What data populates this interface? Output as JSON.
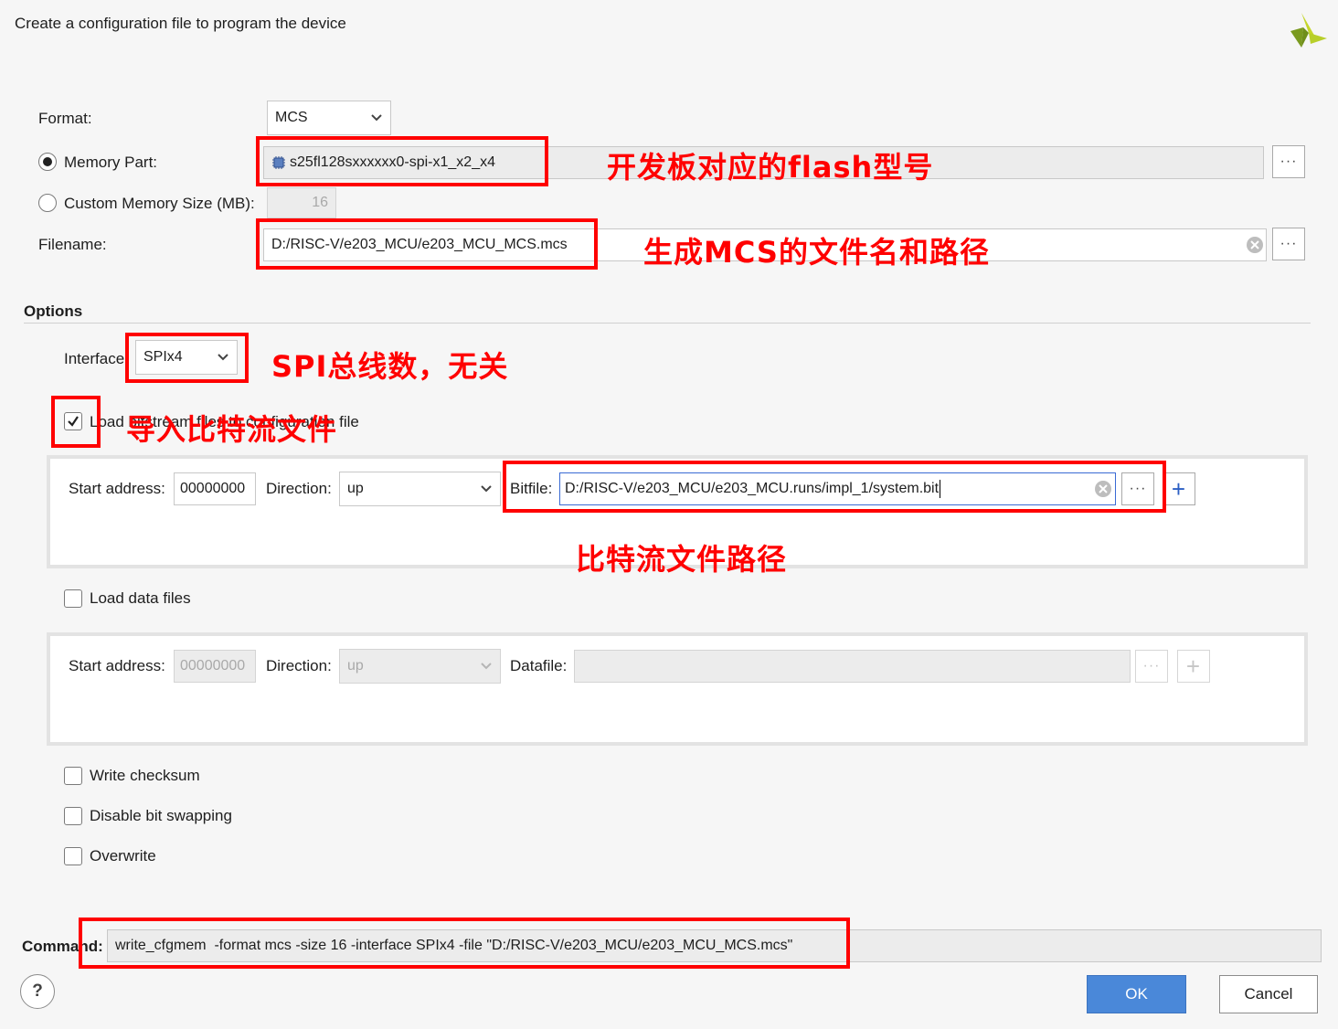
{
  "dialog": {
    "title": "Create a configuration file to program the device"
  },
  "format": {
    "label": "Format:",
    "value": "MCS"
  },
  "memory_part": {
    "label": "Memory Part:",
    "value": "s25fl128sxxxxxx0-spi-x1_x2_x4",
    "selected": true
  },
  "custom_memory": {
    "label": "Custom Memory Size (MB):",
    "value": "16",
    "selected": false
  },
  "filename": {
    "label": "Filename:",
    "value": "D:/RISC-V/e203_MCU/e203_MCU_MCS.mcs"
  },
  "options": {
    "title": "Options",
    "interface_label": "Interface:",
    "interface_value": "SPIx4",
    "load_bitstream_label": "Load bitstream files",
    "load_bitstream_checked": true,
    "load_bitstream_suffix": "to configuration file",
    "bitstream_row": {
      "start_label": "Start address:",
      "start_value": "00000000",
      "direction_label": "Direction:",
      "direction_value": "up",
      "file_label": "Bitfile:",
      "file_value": "D:/RISC-V/e203_MCU/e203_MCU.runs/impl_1/system.bit"
    },
    "load_data_label": "Load data files",
    "load_data_checked": false,
    "data_row": {
      "start_label": "Start address:",
      "start_value": "00000000",
      "direction_label": "Direction:",
      "direction_value": "up",
      "file_label": "Datafile:",
      "file_value": ""
    },
    "write_checksum_label": "Write checksum",
    "disable_bit_swapping_label": "Disable bit swapping",
    "overwrite_label": "Overwrite"
  },
  "command": {
    "label": "Command:",
    "value": "write_cfgmem  -format mcs -size 16 -interface SPIx4 -file \"D:/RISC-V/e203_MCU/e203_MCU_MCS.mcs\""
  },
  "buttons": {
    "browse": "···",
    "add": "+",
    "help": "?",
    "ok": "OK",
    "cancel": "Cancel"
  },
  "annotations": {
    "flash_model": "开发板对应的flash型号",
    "mcs_name_path": "生成MCS的文件名和路径",
    "spi_bus": "SPI总线数，无关",
    "import_bitstream": "导入比特流文件",
    "bitstream_path": "比特流文件路径"
  },
  "colors": {
    "annotation_red": "#ff0000",
    "ok_blue": "#4a88d9",
    "focus_blue": "#3a6ad4",
    "logo_green": "#8aa522"
  },
  "icons": [
    "xilinx-logo-icon",
    "chevron-down-icon",
    "chip-icon",
    "clear-icon",
    "checkmark-icon",
    "ellipsis-icon",
    "plus-icon",
    "help-icon"
  ]
}
